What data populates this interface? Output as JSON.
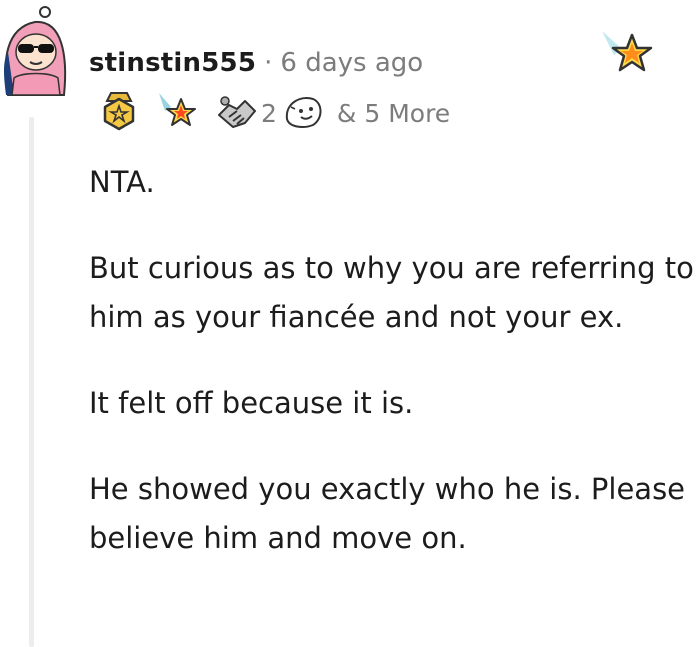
{
  "comment": {
    "author": "stinstin555",
    "separator": "·",
    "timestamp": "6 days ago",
    "awards": [
      {
        "icon": "gold-medal-icon"
      },
      {
        "icon": "rocket-star-icon"
      },
      {
        "icon": "handshake-icon",
        "count": "2"
      },
      {
        "icon": "wholesome-face-icon"
      }
    ],
    "more_awards": "& 5 More",
    "corner_award_icon": "shooting-star-icon",
    "paragraphs": [
      "NTA.",
      "But curious as to why you are referring to him as your fiancée and not your ex.",
      "It felt off because it is.",
      "He showed you exactly who he is. Please believe him and move on."
    ]
  }
}
